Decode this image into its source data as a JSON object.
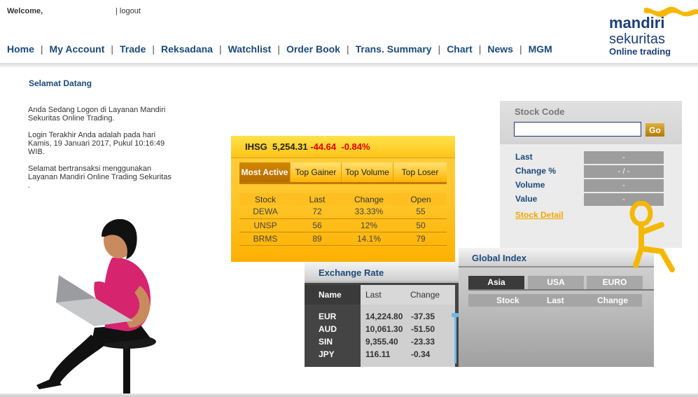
{
  "header": {
    "welcome": "Welcome,",
    "logout": "| logout",
    "nav": [
      "Home",
      "My Account",
      "Trade",
      "Reksadana",
      "Watchlist",
      "Order Book",
      "Trans. Summary",
      "Chart",
      "News",
      "MGM"
    ]
  },
  "logo": {
    "line1": "mandiri",
    "line2": "sekuritas",
    "line3": "Online trading",
    "brand_color": "#1b3f78",
    "accent_color": "#f5b800"
  },
  "welcome_section": {
    "title": "Selamat Datang",
    "para1": "Anda Sedang Logon di Layanan Mandiri Sekuritas Online Trading.",
    "para2": "Login Terakhir Anda adalah pada hari Kamis, 19 Januari 2017, Pukul 10:16:49 WIB.",
    "para3": "Selamat bertransaksi menggunakan Layanan Mandiri Online Trading Sekuritas",
    "para3_dot": "."
  },
  "ihsg": {
    "label": "IHSG",
    "value": "5,254.31",
    "change": "-44.64",
    "change_pct": "-0.84%",
    "tabs": [
      "Most Active",
      "Top Gainer",
      "Top Volume",
      "Top Loser"
    ],
    "active_tab": "Most Active",
    "columns": [
      "Stock",
      "Last",
      "Change",
      "Open"
    ],
    "rows": [
      [
        "DEWA",
        "72",
        "33.33%",
        "55"
      ],
      [
        "UNSP",
        "56",
        "12%",
        "50"
      ],
      [
        "BRMS",
        "89",
        "14.1%",
        "79"
      ]
    ]
  },
  "stock_code": {
    "label": "Stock Code",
    "input_value": "",
    "go": "Go",
    "fields": [
      {
        "label": "Last",
        "value": "-"
      },
      {
        "label": "Change %",
        "value": "- / -"
      },
      {
        "label": "Volume",
        "value": "-"
      },
      {
        "label": "Value",
        "value": "-"
      }
    ],
    "detail_link": "Stock Detail"
  },
  "exchange_rate": {
    "title": "Exchange Rate",
    "columns": [
      "Name",
      "Last",
      "Change"
    ],
    "rows": [
      [
        "EUR",
        "14,224.80",
        "-37.35"
      ],
      [
        "AUD",
        "10,061.30",
        "-51.50"
      ],
      [
        "SIN",
        "9,355.40",
        "-23.33"
      ],
      [
        "JPY",
        "116.11",
        "-0.34"
      ]
    ]
  },
  "global_index": {
    "title": "Global Index",
    "tabs": [
      "Asia",
      "USA",
      "EURO"
    ],
    "active_tab": "Asia",
    "columns": [
      "Stock",
      "Last",
      "Change"
    ]
  }
}
